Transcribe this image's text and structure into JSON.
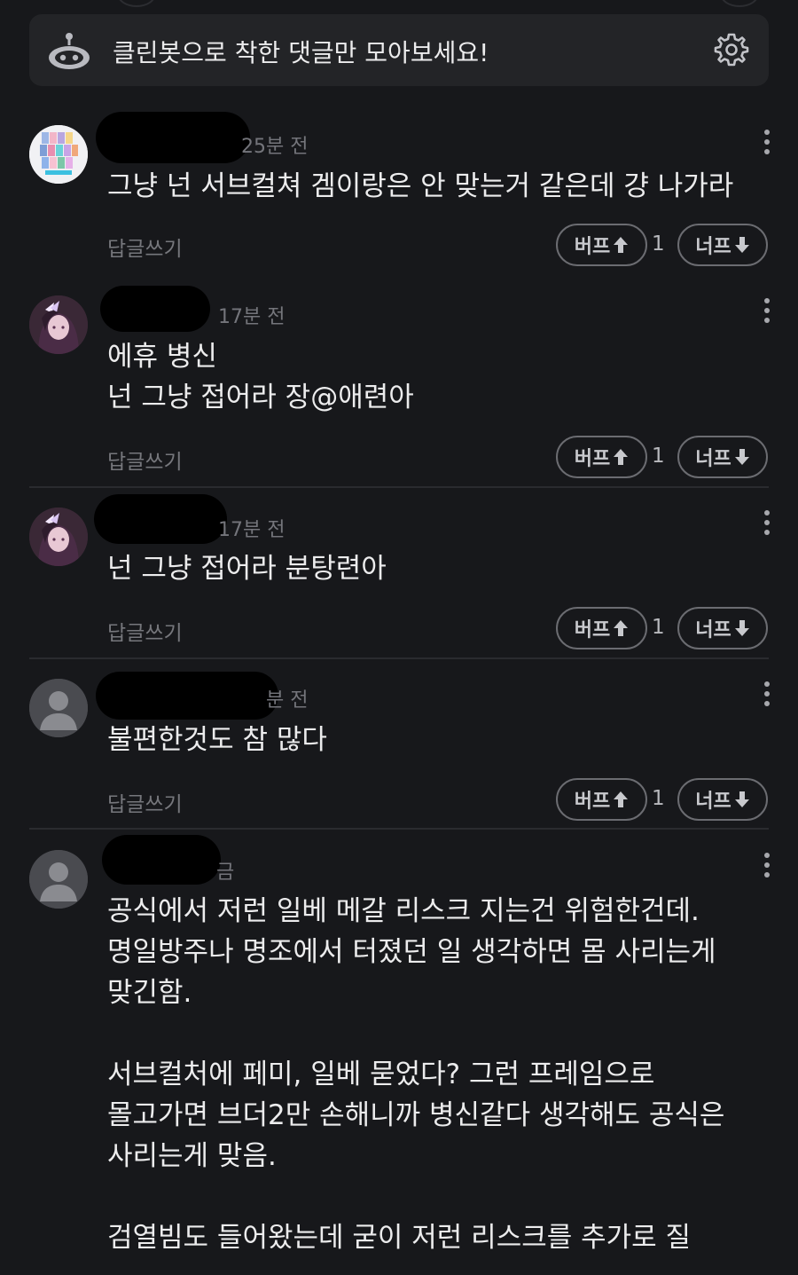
{
  "cleanbot": {
    "text": "클린봇으로 착한 댓글만 모아보세요!",
    "icon": "robot-icon",
    "settings_icon": "gear-icon"
  },
  "labels": {
    "reply": "답글쓰기",
    "buff": "버프",
    "nerf": "너프"
  },
  "comments": [
    {
      "avatar": "collage",
      "time": "25분 전",
      "lines": [
        "그냥 넌 서브컬쳐 겜이랑은 안 맞는거 같은데 걍 나가라"
      ],
      "buff_count": "1"
    },
    {
      "avatar": "anime",
      "time": "17분 전",
      "lines": [
        "에휴 병신",
        "넌 그냥 접어라 장@애련아"
      ],
      "buff_count": "1"
    },
    {
      "avatar": "anime",
      "time": "17분 전",
      "lines": [
        "넌 그냥 접어라 분탕련아"
      ],
      "buff_count": "1"
    },
    {
      "avatar": "default",
      "time": "분 전",
      "lines": [
        "불편한것도 참 많다"
      ],
      "buff_count": "1"
    },
    {
      "avatar": "default",
      "time": "금",
      "lines": [
        "공식에서 저런 일베 메갈 리스크 지는건 위험한건데.",
        "명일방주나 명조에서 터졌던 일 생각하면 몸 사리는게",
        "맞긴함.",
        "",
        "서브컬처에 페미, 일베 묻었다? 그런 프레임으로",
        "몰고가면 브더2만 손해니까 병신같다 생각해도 공식은",
        "사리는게 맞음.",
        "",
        "검열빔도 들어왔는데 굳이 저런 리스크를 추가로 질"
      ]
    }
  ]
}
